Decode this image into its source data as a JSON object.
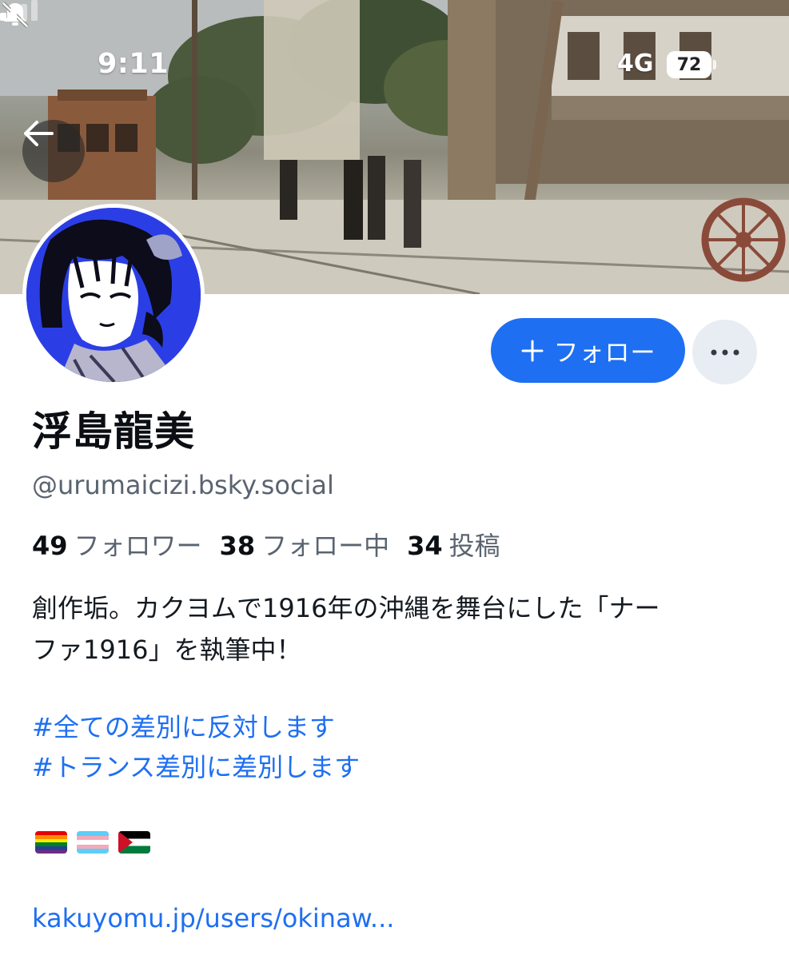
{
  "status_bar": {
    "time": "9:11",
    "network": "4G",
    "battery": "72"
  },
  "profile": {
    "display_name": "浮島龍美",
    "handle": "@urumaicizi.bsky.social",
    "follow_label": "フォロー"
  },
  "stats": [
    {
      "count": "49",
      "label": "フォロワー"
    },
    {
      "count": "38",
      "label": "フォロー中"
    },
    {
      "count": "34",
      "label": "投稿"
    }
  ],
  "bio": {
    "line1": "創作垢。カクヨムで1916年の沖縄を舞台にした「ナー",
    "line2": "ファ1916」を執筆中！",
    "hashtag1": "#全ての差別に反対します",
    "hashtag2": "#トランス差別に差別します",
    "link": "kakuyomu.jp/users/okinaw..."
  },
  "colors": {
    "accent": "#1e6ff2",
    "secondary_text": "#5a6470",
    "more_button_bg": "#e8edf3"
  },
  "icons": [
    "bell-slash-icon",
    "signal-icon",
    "battery-icon",
    "back-arrow-icon",
    "plus-icon",
    "more-dots-icon"
  ],
  "flags": [
    "rainbow-flag",
    "transgender-flag",
    "palestine-flag"
  ]
}
